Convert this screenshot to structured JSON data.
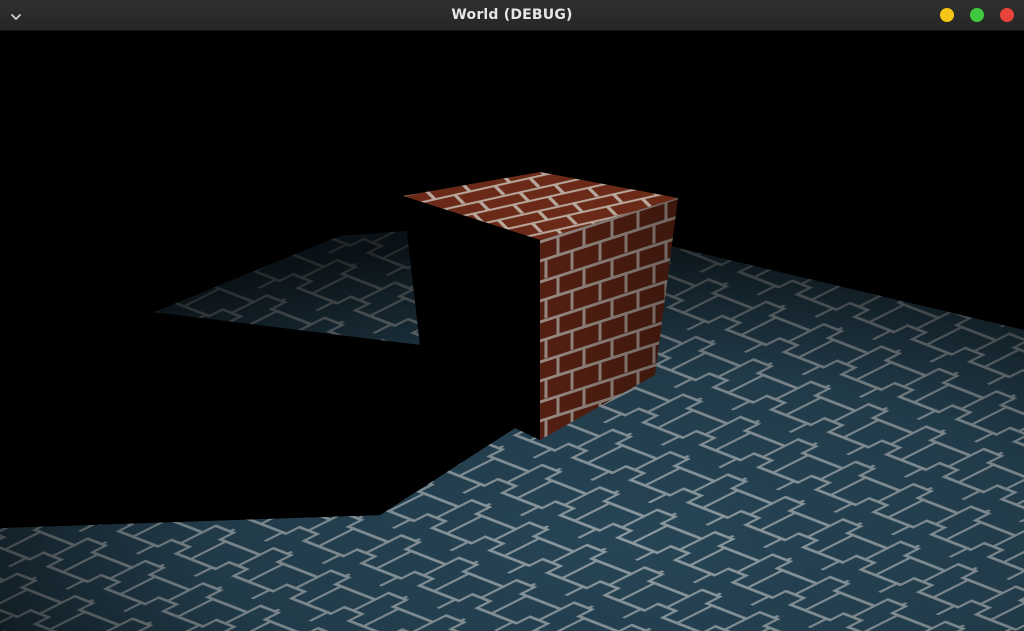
{
  "window": {
    "title": "World (DEBUG)",
    "menu_icon": "chevron-down-icon",
    "controls": [
      {
        "name": "minimize",
        "color": "#f5c518"
      },
      {
        "name": "maximize",
        "color": "#3ec93e"
      },
      {
        "name": "close",
        "color": "#e8433a"
      }
    ]
  },
  "scene": {
    "background": "#000000",
    "floor_color": "#274556",
    "floor_line_color": "#8c9aa0",
    "cube_color": "#6b2a18",
    "mortar_color": "#b8a79c"
  }
}
